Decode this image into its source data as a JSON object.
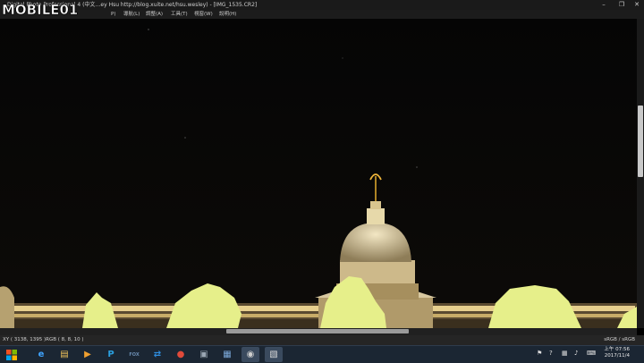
{
  "window": {
    "title": "Digital Photo Professional 4 (中文…ey Hsu http://blog.xuite.net/hsu.wesley) - [IMG_1535.CR2]",
    "minimize_label": "–",
    "restore_label": "❐",
    "close_label": "✕"
  },
  "watermark": {
    "text": "MOBILE01"
  },
  "menu": {
    "items": [
      "P)",
      "導航(L)",
      "調整(A)",
      "工具(T)",
      "視窗(W)",
      "說明(H)"
    ]
  },
  "status": {
    "left": "XY ( 3138, 1395 )RGB (  8,  8, 10 )",
    "right": "sRGB / sRGB"
  },
  "taskbar": {
    "clock_time": "上午 07:56",
    "clock_date": "2017/11/4",
    "apps": [
      {
        "name": "ie-icon",
        "glyph": "e",
        "color": "#3fa4ff"
      },
      {
        "name": "folder-icon",
        "glyph": "▤",
        "color": "#f0c35a"
      },
      {
        "name": "media-player-icon",
        "glyph": "▶",
        "color": "#f0a030"
      },
      {
        "name": "paint-icon",
        "glyph": "P",
        "color": "#2aa0e0"
      },
      {
        "name": "fox-icon",
        "glyph": "FOX",
        "color": "#6a8bb0"
      },
      {
        "name": "teamviewer-icon",
        "glyph": "⇄",
        "color": "#2f8ee0"
      },
      {
        "name": "chrome-icon",
        "glyph": "●",
        "color": "#e04a3a"
      },
      {
        "name": "camera-app-icon",
        "glyph": "▣",
        "color": "#9aa6b3"
      },
      {
        "name": "photo-viewer-icon",
        "glyph": "▦",
        "color": "#7aa7d8"
      },
      {
        "name": "dpp-icon",
        "glyph": "◉",
        "color": "#cfcfcf"
      },
      {
        "name": "dpp-editor-icon",
        "glyph": "▧",
        "color": "#d9d9d9"
      }
    ]
  },
  "colors": {
    "highlight": "#e6ef8a",
    "building": "#c9b88e",
    "window_bg": "#1a1a1a"
  }
}
